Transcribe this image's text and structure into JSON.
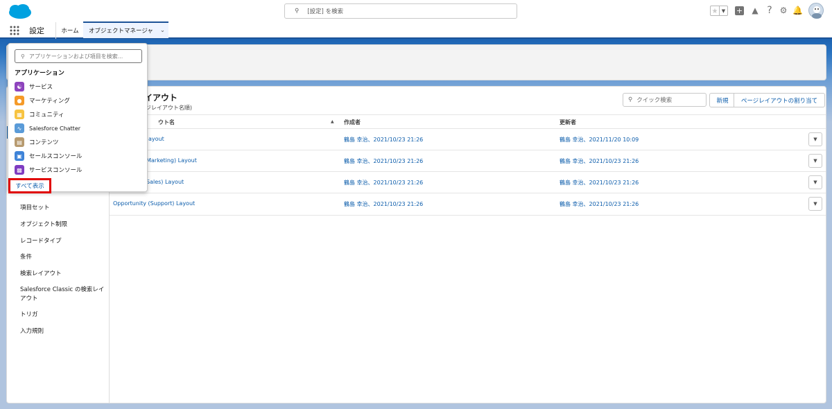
{
  "header": {
    "search_placeholder": "[設定] を検索"
  },
  "nav": {
    "app_name": "設定",
    "tabs": [
      {
        "label": "ホーム"
      },
      {
        "label": "オブジェクトマネージャ"
      }
    ]
  },
  "launcher": {
    "search_placeholder": "アプリケーションおよび項目を検索...",
    "section_title": "アプリケーション",
    "apps": [
      {
        "label": "サービス",
        "color": "#8e44bd"
      },
      {
        "label": "マーケティング",
        "color": "#f59a28"
      },
      {
        "label": "コミュニティ",
        "color": "#f7c340"
      },
      {
        "label": "Salesforce Chatter",
        "color": "#5a9bd8"
      },
      {
        "label": "コンテンツ",
        "color": "#b79a6f"
      },
      {
        "label": "セールスコンソール",
        "color": "#3e83d8"
      },
      {
        "label": "サービスコンソール",
        "color": "#7f3cc1"
      }
    ],
    "show_all": "すべて表示"
  },
  "sidebar": {
    "items": [
      {
        "label": "項目セット"
      },
      {
        "label": "オブジェクト制限"
      },
      {
        "label": "レコードタイプ"
      },
      {
        "label": "条件"
      },
      {
        "label": "検索レイアウト"
      },
      {
        "label": "Salesforce Classic の検索レイアウト"
      },
      {
        "label": "トリガ"
      },
      {
        "label": "入力規則"
      }
    ]
  },
  "main": {
    "title_fragment": "イアウト",
    "subtitle_fragment": "ージレイアウト名順)",
    "quick_search_placeholder": "クイック検索",
    "new_button": "新規",
    "assign_button": "ページレイアウトの割り当て",
    "columns": {
      "name": "ウト名",
      "created_by": "作成者",
      "modified_by": "更新者"
    },
    "rows": [
      {
        "name": "ayout",
        "created": "鶴島 幸治、2021/10/23 21:26",
        "modified": "鶴島 幸治、2021/11/20 10:09"
      },
      {
        "name": "(Marketing) Layout",
        "created": "鶴島 幸治、2021/10/23 21:26",
        "modified": "鶴島 幸治、2021/10/23 21:26"
      },
      {
        "name": "Sales) Layout",
        "created": "鶴島 幸治、2021/10/23 21:26",
        "modified": "鶴島 幸治、2021/10/23 21:26"
      },
      {
        "name": "Opportunity (Support) Layout",
        "created": "鶴島 幸治、2021/10/23 21:26",
        "modified": "鶴島 幸治、2021/10/23 21:26"
      }
    ]
  },
  "colors": {
    "brand": "#00a1e0",
    "link": "#0b5cab",
    "highlight_border": "#e00000"
  }
}
